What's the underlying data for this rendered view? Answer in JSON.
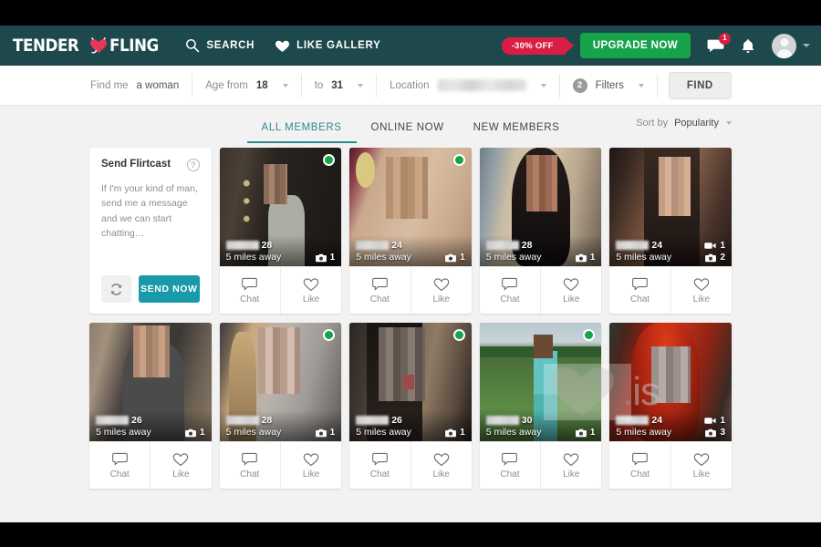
{
  "header": {
    "logo_text_1": "TENDER",
    "logo_text_2": "FLING",
    "logo_icon": "devil-heart-icon",
    "search_label": "SEARCH",
    "search_icon": "magnifier-icon",
    "like_gallery_label": "LIKE GALLERY",
    "like_gallery_icon": "heart-filled-icon",
    "deal_badge": "-30% OFF",
    "upgrade_label": "UPGRADE NOW",
    "messages_icon": "chat-bubble-icon",
    "messages_count": "1",
    "bell_icon": "bell-icon",
    "avatar_icon": "user-avatar-icon",
    "account_caret_icon": "chevron-down-icon",
    "accent_teal": "#1e494c",
    "accent_green": "#16a34a",
    "accent_red": "#d81e45"
  },
  "searchbar": {
    "find_me_label": "Find me",
    "find_me_value": "a woman",
    "age_from_label": "Age from",
    "age_from_value": "18",
    "age_to_label": "to",
    "age_to_value": "31",
    "location_label": "Location",
    "location_value": "",
    "filters_label": "Filters",
    "filters_count": "2",
    "find_button": "FIND"
  },
  "tabs": [
    {
      "label": "ALL MEMBERS",
      "active": true
    },
    {
      "label": "ONLINE NOW",
      "active": false
    },
    {
      "label": "NEW MEMBERS",
      "active": false
    }
  ],
  "sort": {
    "label": "Sort by",
    "value": "Popularity",
    "caret_icon": "chevron-down-icon"
  },
  "flirtcast": {
    "title": "Send Flirtcast",
    "help_icon": "question-mark-icon",
    "message": "If I'm your kind of man, send me a message and we can start chatting…",
    "refresh_icon": "refresh-icon",
    "send_label": "SEND NOW",
    "send_color": "#199aab"
  },
  "card_actions": {
    "chat_label": "Chat",
    "chat_icon": "chat-bubble-icon",
    "like_label": "Like",
    "like_icon": "heart-outline-icon"
  },
  "watermark": {
    "text": ".is"
  },
  "profiles": [
    {
      "name": "",
      "age": "28",
      "distance": "5 miles away",
      "online": true,
      "photos": "1",
      "videos": "",
      "tone": "dim-indoor"
    },
    {
      "name": "",
      "age": "24",
      "distance": "5 miles away",
      "online": true,
      "photos": "1",
      "videos": "",
      "tone": "warm-portrait"
    },
    {
      "name": "",
      "age": "28",
      "distance": "5 miles away",
      "online": false,
      "photos": "1",
      "videos": "",
      "tone": "dark-hair"
    },
    {
      "name": "",
      "age": "24",
      "distance": "5 miles away",
      "online": false,
      "photos": "2",
      "videos": "1",
      "tone": "brown-room"
    },
    {
      "name": "",
      "age": "26",
      "distance": "5 miles away",
      "online": false,
      "photos": "1",
      "videos": "",
      "tone": "grey-hoodie"
    },
    {
      "name": "",
      "age": "28",
      "distance": "5 miles away",
      "online": true,
      "photos": "1",
      "videos": "",
      "tone": "blonde"
    },
    {
      "name": "",
      "age": "26",
      "distance": "5 miles away",
      "online": true,
      "photos": "1",
      "videos": "",
      "tone": "dark-selfie"
    },
    {
      "name": "",
      "age": "30",
      "distance": "5 miles away",
      "online": true,
      "photos": "1",
      "videos": "",
      "tone": "outdoor-grass"
    },
    {
      "name": "",
      "age": "24",
      "distance": "5 miles away",
      "online": false,
      "photos": "3",
      "videos": "1",
      "tone": "red-hair"
    }
  ]
}
